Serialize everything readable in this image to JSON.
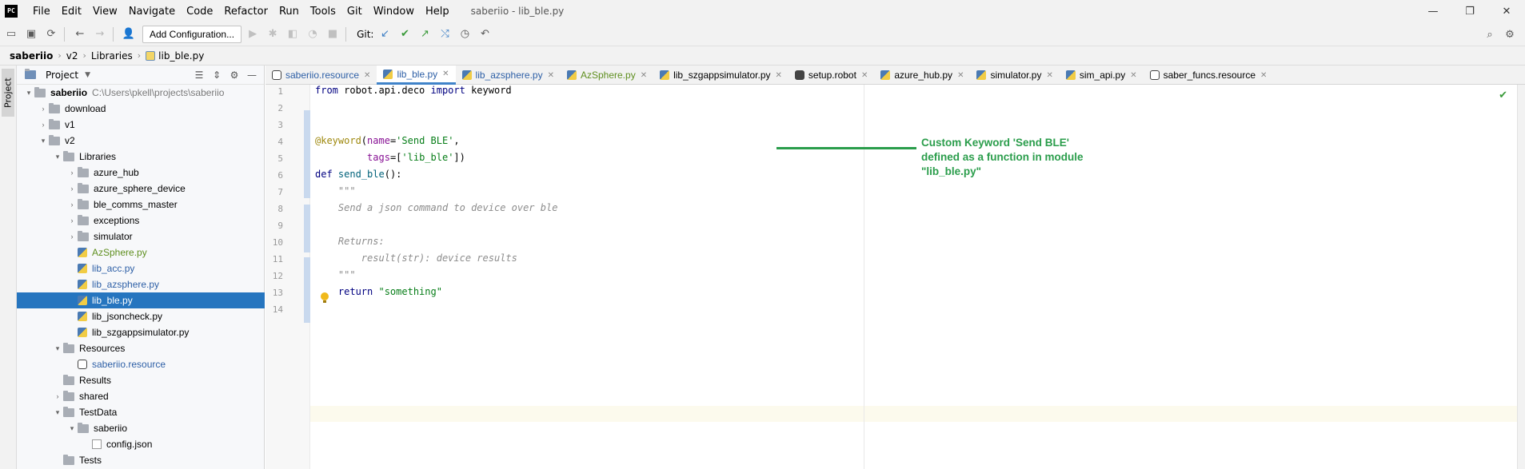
{
  "window": {
    "title": "saberiio - lib_ble.py",
    "logo": "PC",
    "controls": [
      "—",
      "❐",
      "✕"
    ]
  },
  "menu": [
    "File",
    "Edit",
    "View",
    "Navigate",
    "Code",
    "Refactor",
    "Run",
    "Tools",
    "Git",
    "Window",
    "Help"
  ],
  "toolbar": {
    "run_config": "Add Configuration...",
    "git_label": "Git:"
  },
  "breadcrumb": [
    "saberiio",
    "v2",
    "Libraries",
    "lib_ble.py"
  ],
  "project_panel": {
    "title": "Project",
    "strip_label": "Project"
  },
  "tree": [
    {
      "label": "saberiio",
      "hint": "C:\\Users\\pkell\\projects\\saberiio",
      "depth": 0,
      "type": "folder",
      "arrow": "▾",
      "bold": true
    },
    {
      "label": "download",
      "depth": 1,
      "type": "folder",
      "arrow": "›"
    },
    {
      "label": "v1",
      "depth": 1,
      "type": "folder",
      "arrow": "›"
    },
    {
      "label": "v2",
      "depth": 1,
      "type": "folder",
      "arrow": "▾"
    },
    {
      "label": "Libraries",
      "depth": 2,
      "type": "folder",
      "arrow": "▾"
    },
    {
      "label": "azure_hub",
      "depth": 3,
      "type": "folder",
      "arrow": "›"
    },
    {
      "label": "azure_sphere_device",
      "depth": 3,
      "type": "folder",
      "arrow": "›"
    },
    {
      "label": "ble_comms_master",
      "depth": 3,
      "type": "folder",
      "arrow": "›"
    },
    {
      "label": "exceptions",
      "depth": 3,
      "type": "folder",
      "arrow": "›"
    },
    {
      "label": "simulator",
      "depth": 3,
      "type": "folder",
      "arrow": "›"
    },
    {
      "label": "AzSphere.py",
      "depth": 3,
      "type": "py",
      "color": "green"
    },
    {
      "label": "lib_acc.py",
      "depth": 3,
      "type": "py",
      "color": "blue"
    },
    {
      "label": "lib_azsphere.py",
      "depth": 3,
      "type": "py",
      "color": "blue"
    },
    {
      "label": "lib_ble.py",
      "depth": 3,
      "type": "py",
      "selected": true
    },
    {
      "label": "lib_jsoncheck.py",
      "depth": 3,
      "type": "py"
    },
    {
      "label": "lib_szgappsimulator.py",
      "depth": 3,
      "type": "py"
    },
    {
      "label": "Resources",
      "depth": 2,
      "type": "folder",
      "arrow": "▾"
    },
    {
      "label": "saberiio.resource",
      "depth": 3,
      "type": "res",
      "color": "blue"
    },
    {
      "label": "Results",
      "depth": 2,
      "type": "folder"
    },
    {
      "label": "shared",
      "depth": 2,
      "type": "folder",
      "arrow": "›"
    },
    {
      "label": "TestData",
      "depth": 2,
      "type": "folder",
      "arrow": "▾"
    },
    {
      "label": "saberiio",
      "depth": 3,
      "type": "folder",
      "arrow": "▾"
    },
    {
      "label": "config.json",
      "depth": 4,
      "type": "json"
    },
    {
      "label": "Tests",
      "depth": 2,
      "type": "folder"
    }
  ],
  "tabs": [
    {
      "label": "saberiio.resource",
      "icon": "res",
      "color": "blue"
    },
    {
      "label": "lib_ble.py",
      "icon": "py",
      "color": "blue",
      "active": true
    },
    {
      "label": "lib_azsphere.py",
      "icon": "py",
      "color": "blue"
    },
    {
      "label": "AzSphere.py",
      "icon": "py",
      "color": "green"
    },
    {
      "label": "lib_szgappsimulator.py",
      "icon": "py"
    },
    {
      "label": "setup.robot",
      "icon": "robot"
    },
    {
      "label": "azure_hub.py",
      "icon": "py"
    },
    {
      "label": "simulator.py",
      "icon": "py"
    },
    {
      "label": "sim_api.py",
      "icon": "py"
    },
    {
      "label": "saber_funcs.resource",
      "icon": "res"
    }
  ],
  "code": {
    "line_numbers": [
      "1",
      "2",
      "3",
      "4",
      "5",
      "6",
      "7",
      "8",
      "9",
      "10",
      "11",
      "12",
      "13",
      "14"
    ],
    "l1_from": "from",
    "l1_mod": " robot.api.deco ",
    "l1_import": "import",
    "l1_name": " keyword",
    "l4_dec": "@keyword",
    "l4_open": "(",
    "l4_param": "name",
    "l4_eq": "=",
    "l4_str": "'Send BLE'",
    "l4_comma": ",",
    "l5_indent": "         ",
    "l5_param": "tags",
    "l5_eq": "=[",
    "l5_str": "'lib_ble'",
    "l5_close": "])",
    "l6_def": "def",
    "l6_fn": " send_ble",
    "l6_rest": "():",
    "l7": "    \"\"\"",
    "l8": "    Send a json command to device over ble",
    "l10": "    Returns:",
    "l11": "        result(str): device results",
    "l12": "    \"\"\"",
    "l13_ret": "    return ",
    "l13_str": "\"something\""
  },
  "annotation": "Custom Keyword 'Send BLE' defined as a function in module \"lib_ble.py\"",
  "colors": {
    "selection": "#2675bf",
    "annotation": "#2a9d4b",
    "active_tab_underline": "#4083c9"
  }
}
